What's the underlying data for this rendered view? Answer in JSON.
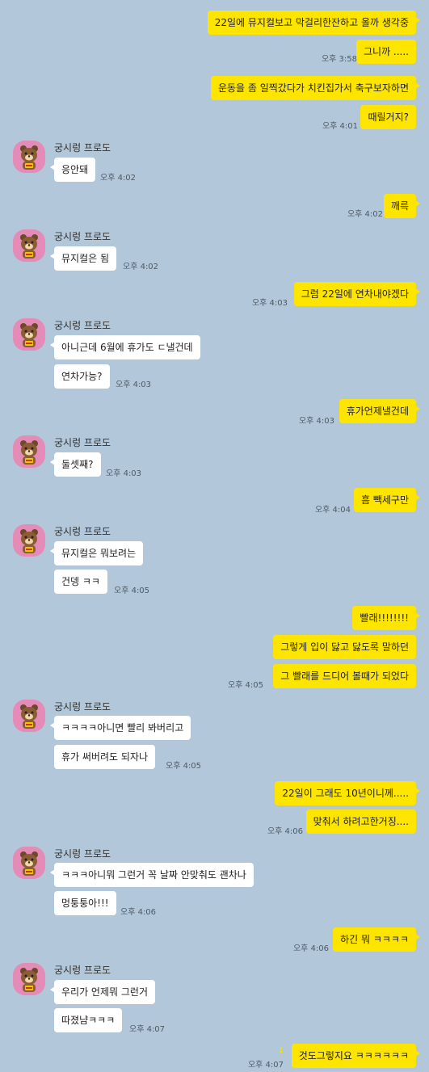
{
  "contact": {
    "name": "궁시렁 프로도"
  },
  "messages": [
    {
      "text": "22일에 뮤지컬보고 막걸리한잔하고 올까 생각중"
    },
    {
      "text": "그니까 .....",
      "time": "오후 3:58"
    },
    {
      "text": "운동을 좀 일찍갔다가 치킨집가서 축구보자하면"
    },
    {
      "text": "때릴거지?",
      "time": "오후 4:01"
    },
    {
      "text": "응안돼",
      "time": "오후 4:02"
    },
    {
      "text": "깨륵",
      "time": "오후 4:02"
    },
    {
      "text": "뮤지컬은 됨",
      "time": "오후 4:02"
    },
    {
      "text": "그럼 22일에 연차내야겠다",
      "time": "오후 4:03"
    },
    {
      "text": "아니근데 6월에 휴가도 ㄷ낼건데"
    },
    {
      "text": "연차가능?",
      "time": "오후 4:03"
    },
    {
      "text": "휴가언제낼건데",
      "time": "오후 4:03"
    },
    {
      "text": "둘셋째?",
      "time": "오후 4:03"
    },
    {
      "text": "흠 빽세구만",
      "time": "오후 4:04"
    },
    {
      "text": "뮤지컬은 뭐보려는"
    },
    {
      "text": "건뎅 ㅋㅋ",
      "time": "오후 4:05"
    },
    {
      "text": "빨래!!!!!!!!"
    },
    {
      "text": "그렇게 입이 닳고 닳도록 말하던"
    },
    {
      "text": "그 빨래를 드디어 볼때가 되었다",
      "time": "오후 4:05"
    },
    {
      "text": "ㅋㅋㅋㅋ아니면 빨리 봐버리고"
    },
    {
      "text": "휴가 써버려도 되자나",
      "time": "오후 4:05"
    },
    {
      "text": "22일이 그래도 10년이니께....."
    },
    {
      "text": "맞춰서 하려고한거징....",
      "time": "오후 4:06"
    },
    {
      "text": "ㅋㅋㅋ아니뭐 그런거 꼭 날짜 안맞춰도 괜차나"
    },
    {
      "text": "멍퉁퉁아!!!",
      "time": "오후 4:06"
    },
    {
      "text": "하긴 뭐 ㅋㅋㅋㅋ",
      "time": "오후 4:06"
    },
    {
      "text": "우리가 언제뭐 그런거"
    },
    {
      "text": "따졌냠ㅋㅋㅋ",
      "time": "오후 4:07"
    },
    {
      "text": "것도그렇지요 ㅋㅋㅋㅋㅋㅋ",
      "time": "오후 4:07",
      "unread": "1"
    }
  ]
}
